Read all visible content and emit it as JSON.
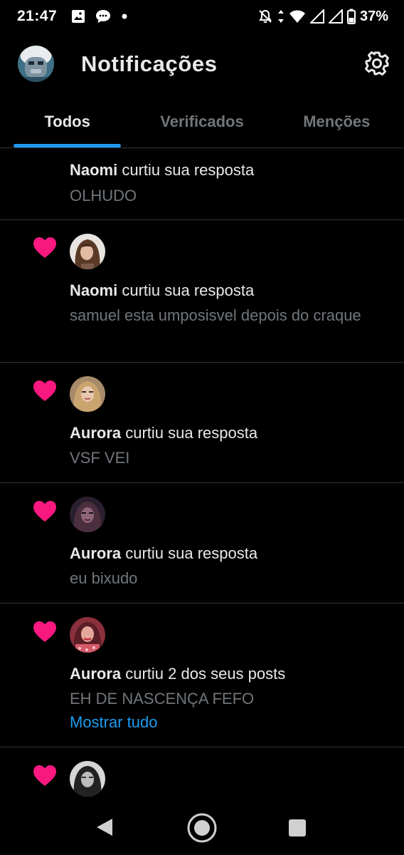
{
  "status_bar": {
    "time": "21:47",
    "battery": "37%",
    "icons_left": [
      "image-icon",
      "chat-bubble-icon",
      "dot-icon"
    ],
    "icons_right": [
      "bell-off-icon",
      "wifi-icon",
      "signal-icon",
      "signal-icon",
      "battery-icon"
    ]
  },
  "header": {
    "title": "Notificações"
  },
  "tabs": [
    {
      "label": "Todos",
      "active": true
    },
    {
      "label": "Verificados",
      "active": false
    },
    {
      "label": "Menções",
      "active": false
    }
  ],
  "notifications": [
    {
      "name": "Naomi",
      "action": " curtiu sua resposta",
      "text": "OLHUDO",
      "link": ""
    },
    {
      "name": "Naomi",
      "action": " curtiu sua resposta",
      "text": "samuel esta umposisvel depois do craque",
      "link": ""
    },
    {
      "name": "Aurora",
      "action": " curtiu sua resposta",
      "text": "VSF VEI",
      "link": ""
    },
    {
      "name": "Aurora",
      "action": " curtiu sua resposta",
      "text": "eu bixudo",
      "link": ""
    },
    {
      "name": "Aurora",
      "action": " curtiu 2 dos seus posts",
      "text": "EH DE NASCENÇA FEFO",
      "link": "Mostrar tudo"
    },
    {
      "name": "",
      "action": "",
      "text": "",
      "link": ""
    }
  ],
  "colors": {
    "background": "#000000",
    "accent": "#1d9bf0",
    "heart": "#f91880",
    "secondary_text": "#71767b",
    "divider": "#2f3336"
  }
}
